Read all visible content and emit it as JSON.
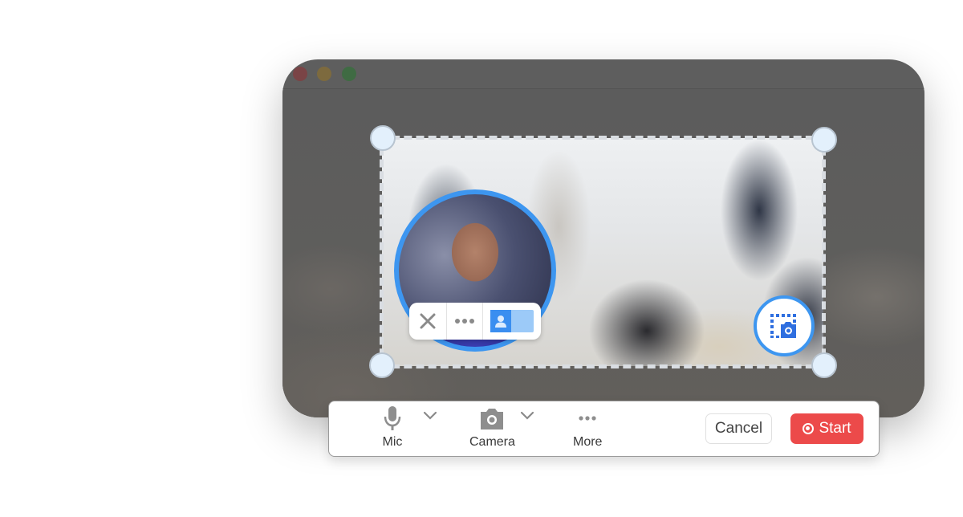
{
  "window": {
    "traffic_lights": [
      "close",
      "minimize",
      "zoom"
    ]
  },
  "capture_region": {
    "handles": [
      "top-left",
      "top-right",
      "bottom-left",
      "bottom-right"
    ],
    "screenshot_icon": "screenshot-camera-icon"
  },
  "webcam_bubble": {
    "toolbar": {
      "close_icon": "close-x-icon",
      "more_icon": "ellipsis-icon",
      "toggle_icon": "person-icon",
      "toggle_on": true
    }
  },
  "controls": {
    "mic": {
      "label": "Mic",
      "icon": "microphone-icon"
    },
    "camera": {
      "label": "Camera",
      "icon": "camera-icon"
    },
    "more": {
      "label": "More",
      "icon": "ellipsis-icon"
    },
    "cancel_label": "Cancel",
    "start_label": "Start"
  },
  "colors": {
    "accent": "#3d96f0",
    "start": "#ec4a4a",
    "handle_fill": "#e3f0fc"
  }
}
